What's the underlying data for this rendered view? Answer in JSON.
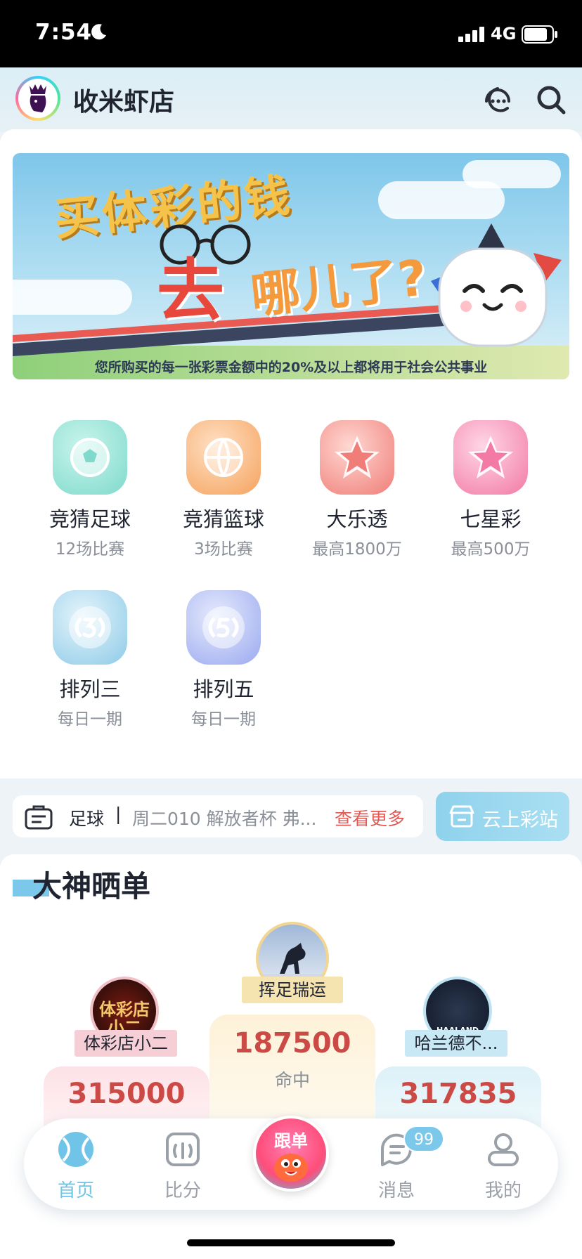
{
  "status_bar": {
    "time": "7:54",
    "network": "4G"
  },
  "header": {
    "shop_name": "收米虾店",
    "icons": [
      "customer-service-icon",
      "search-icon"
    ]
  },
  "banner": {
    "line1": "买体彩的钱",
    "line2_a": "去",
    "line2_b": "哪儿了?",
    "caption": "您所购买的每一张彩票金额中的20%及以上都将用于社会公共事业"
  },
  "categories": [
    {
      "title": "竞猜足球",
      "sub": "12场比赛",
      "icon": "football-icon",
      "color": "#7fdacc"
    },
    {
      "title": "竞猜篮球",
      "sub": "3场比赛",
      "icon": "basketball-icon",
      "color": "#f5a35e"
    },
    {
      "title": "大乐透",
      "sub": "最高1800万",
      "icon": "star-le-icon",
      "color": "#f07d78"
    },
    {
      "title": "七星彩",
      "sub": "最高500万",
      "icon": "star-qi-icon",
      "color": "#f27aa5"
    },
    {
      "title": "排列三",
      "sub": "每日一期",
      "icon": "arrange-three-icon",
      "color": "#8fcbe8"
    },
    {
      "title": "排列五",
      "sub": "每日一期",
      "icon": "arrange-five-icon",
      "color": "#9aaaf0"
    }
  ],
  "ticker": {
    "category": "足球",
    "separator": "|",
    "text": "周二010 解放者杯 弗...",
    "more": "查看更多"
  },
  "cloud_station": {
    "label": "云上彩站"
  },
  "leaderboard": {
    "title": "大神晒单",
    "entries": [
      {
        "rank": 1,
        "name": "挥足瑞运",
        "value": "187500",
        "label": "命中"
      },
      {
        "rank": 2,
        "name": "体彩店小二",
        "value": "315000",
        "avatar_text": "体彩店小二"
      },
      {
        "rank": 3,
        "name": "哈兰德不...",
        "value": "317835",
        "avatar_text": "HAALAND"
      }
    ]
  },
  "tabbar": {
    "tabs": [
      {
        "label": "首页",
        "icon": "home-ball-icon",
        "active": true
      },
      {
        "label": "比分",
        "icon": "score-icon",
        "active": false
      },
      {
        "label": "跟单",
        "icon": "follow-mascot-icon",
        "active": false
      },
      {
        "label": "消息",
        "icon": "message-icon",
        "active": false,
        "badge": "99"
      },
      {
        "label": "我的",
        "icon": "profile-icon",
        "active": false
      }
    ]
  }
}
